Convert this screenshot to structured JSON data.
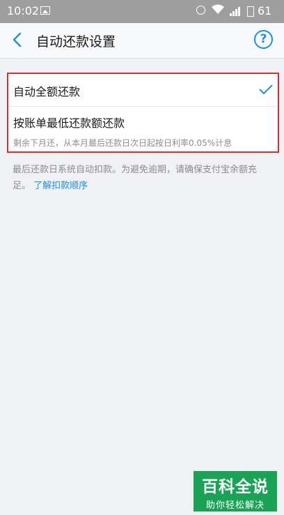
{
  "status_bar": {
    "time": "10:02",
    "battery": "61",
    "icons": [
      "image-icon",
      "alarm-icon",
      "wifi-icon",
      "signal-icon",
      "battery-icon"
    ]
  },
  "header": {
    "back_icon": "back-arrow-icon",
    "title": "自动还款设置",
    "help_icon": "help-icon",
    "help_symbol": "?"
  },
  "options": [
    {
      "label": "自动全额还款",
      "selected": true
    },
    {
      "label": "按账单最低还款额还款",
      "description": "剩余下月还，从本月最后还款日次日起按日利率0.05%计息",
      "selected": false
    }
  ],
  "notice": {
    "text": "最后还款日系统自动扣款。为避免逾期，请确保支付宝余额充足。",
    "link": "了解扣款顺序"
  },
  "watermark": {
    "title": "百科全说",
    "subtitle": "助你轻松解决"
  },
  "colors": {
    "accent": "#1a90e0",
    "highlight_border": "#e8262d",
    "watermark_bg": "#19a455",
    "status_bar_bg": "#9e9e9e"
  }
}
